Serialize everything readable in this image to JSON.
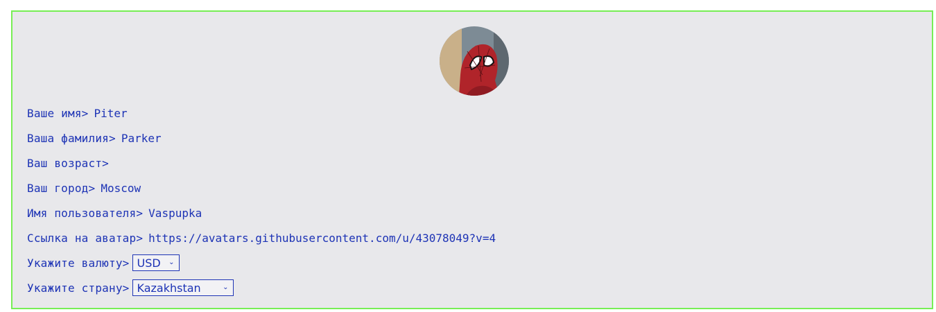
{
  "profile": {
    "avatar_icon": "spider-man-avatar",
    "fields": [
      {
        "label": "Ваше имя>",
        "value": "Piter"
      },
      {
        "label": "Ваша фамилия>",
        "value": "Parker"
      },
      {
        "label": "Ваш возраст>",
        "value": ""
      },
      {
        "label": "Ваш город>",
        "value": "Moscow"
      },
      {
        "label": "Имя пользователя>",
        "value": "Vaspupka"
      },
      {
        "label": "Ссылка на аватар>",
        "value": "https://avatars.githubusercontent.com/u/43078049?v=4"
      }
    ],
    "currency": {
      "label": "Укажите валюту>",
      "selected": "USD"
    },
    "country": {
      "label": "Укажите страну>",
      "selected": "Kazakhstan"
    }
  },
  "colors": {
    "text": "#1d33b5",
    "panel_background": "#e8e8eb",
    "panel_border": "#77ee55"
  }
}
